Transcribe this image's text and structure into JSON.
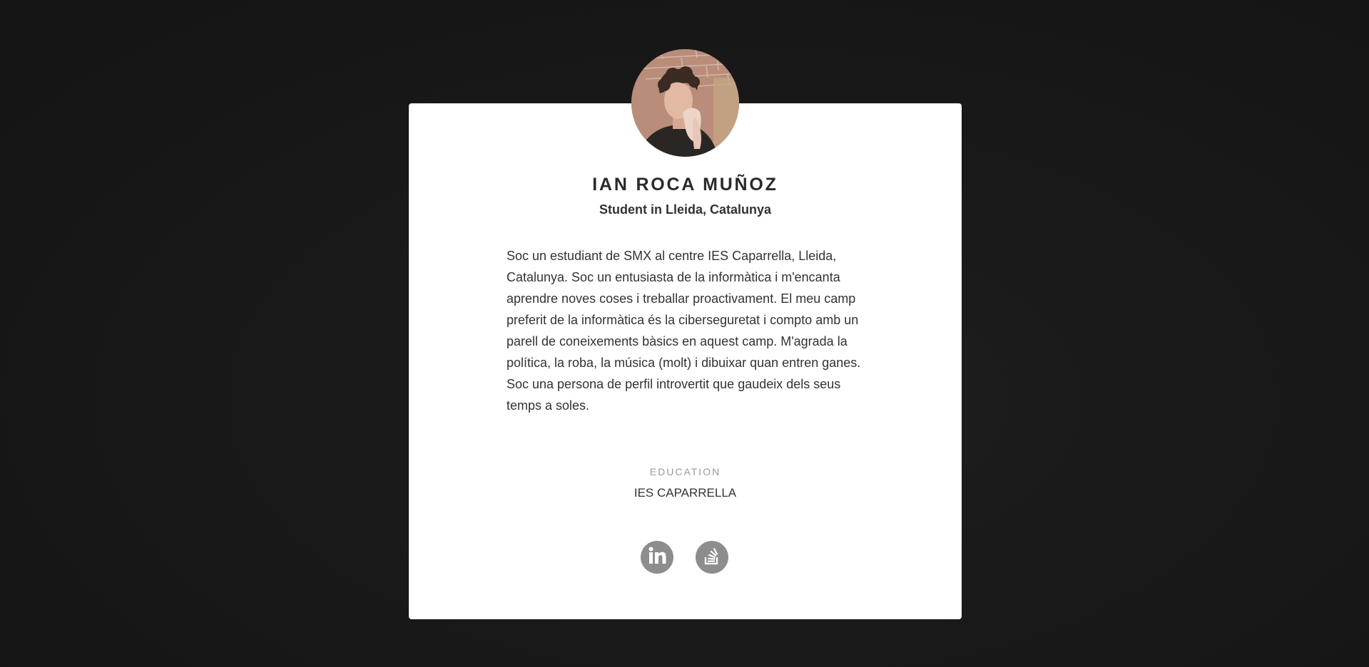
{
  "profile": {
    "name": "IAN ROCA MUÑOZ",
    "subtitle": "Student in Lleida, Catalunya",
    "bio": "Soc un estudiant de SMX al centre IES Caparrella, Lleida, Catalunya. Soc un entusiasta de la informàtica i m'encanta aprendre noves coses i treballar proactivament. El meu camp preferit de la informàtica és la ciberseguretat i compto amb un parell de coneixements bàsics en aquest camp. M'agrada la política, la roba, la música (molt) i dibuixar quan entren ganes. Soc una persona de perfil introvertit que gaudeix dels seus temps a soles."
  },
  "education": {
    "label": "EDUCATION",
    "value": "IES CAPARRELLA"
  },
  "social": [
    {
      "icon": "linkedin-icon"
    },
    {
      "icon": "stack-overflow-icon"
    }
  ],
  "colors": {
    "background": "#181818",
    "card": "#ffffff",
    "text": "#333333",
    "muted": "#9a9a9a",
    "icon_bg": "#8d8d8d"
  }
}
